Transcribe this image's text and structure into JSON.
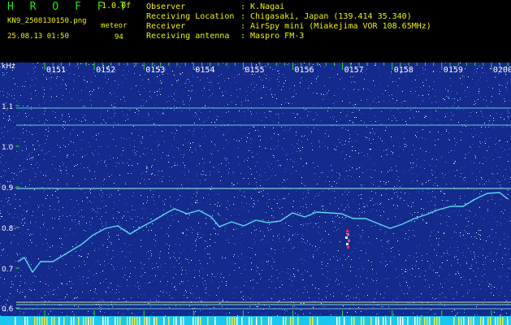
{
  "header": {
    "logo": "H R O F F T",
    "version": "1.0.0f",
    "filename": "KN9_2508130150.png",
    "datetime": "25.08.13 01:50",
    "meteor_label": "meteor",
    "meteor_count": "94",
    "info": [
      {
        "key": "Observer",
        "value": ": K.Nagai"
      },
      {
        "key": "Receiving Location",
        "value": ": Chigasaki, Japan (139.414 35.340)"
      },
      {
        "key": "Receiver",
        "value": ": AirSpy mini (Miakejima VOR 108.65MHz)"
      },
      {
        "key": "Receiving antenna",
        "value": ": Maspro FM-3"
      }
    ]
  },
  "spectrogram": {
    "y_unit": "kHz",
    "y_ticks": [
      "1.1",
      "1.0",
      "0.9",
      "0.8",
      "0.7",
      "0.6"
    ],
    "time_ticks": [
      "0151",
      "0152",
      "0153",
      "0154",
      "0155",
      "0156",
      "0157",
      "0158",
      "0159",
      "0200"
    ],
    "colors": {
      "background": "#142a8c",
      "tick": "#24e81a",
      "axis_text": "#ffffff",
      "trace": "#5ad8f0",
      "line": "#8fe8e0"
    }
  }
}
